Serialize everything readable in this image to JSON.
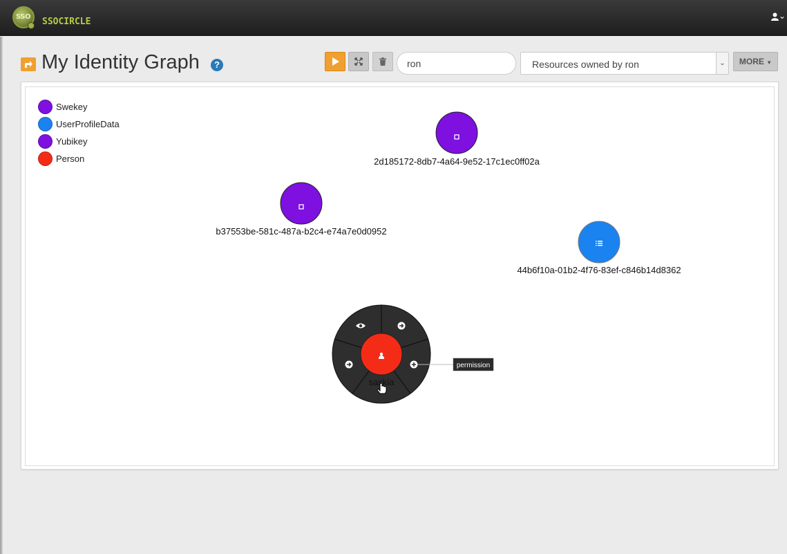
{
  "app": {
    "logo_badge": "SSO",
    "logo_text": "SSOCIRCLE"
  },
  "header": {
    "user_icon": "user-icon",
    "user_menu_caret": "⌄"
  },
  "page": {
    "title": "My Identity Graph",
    "help_glyph": "?"
  },
  "toolbar": {
    "play_icon": "play-icon",
    "expand_icon": "expand-icon",
    "trash_icon": "trash-icon",
    "search_value": "ron",
    "filter_selected": "Resources owned by ron",
    "more_label": "MORE"
  },
  "legend": [
    {
      "label": "Swekey",
      "color": "#7e10e0"
    },
    {
      "label": "UserProfileData",
      "color": "#1a83f0"
    },
    {
      "label": "Yubikey",
      "color": "#7e10e0"
    },
    {
      "label": "Person",
      "color": "#f42c17"
    }
  ],
  "graph": {
    "nodes": [
      {
        "id": "swekey",
        "label": "2d185172-8db7-4a64-9e52-17c1ec0ff02a",
        "type": "Swekey",
        "icon": "square-icon"
      },
      {
        "id": "yubikey",
        "label": "b37553be-581c-487a-b2c4-e74a7e0d0952",
        "type": "Yubikey",
        "icon": "square-icon"
      },
      {
        "id": "profile",
        "label": "44b6f10a-01b2-4f76-83ef-c846b14d8362",
        "type": "UserProfileData",
        "icon": "list-icon"
      },
      {
        "id": "person",
        "label": "saskia",
        "type": "Person",
        "icon": "person-icon"
      }
    ],
    "radial_menu": {
      "items": [
        "eye-icon",
        "arrow-circle-icon",
        "plus-circle-icon",
        "arrow-circle-icon"
      ],
      "tooltip": "permission"
    }
  }
}
